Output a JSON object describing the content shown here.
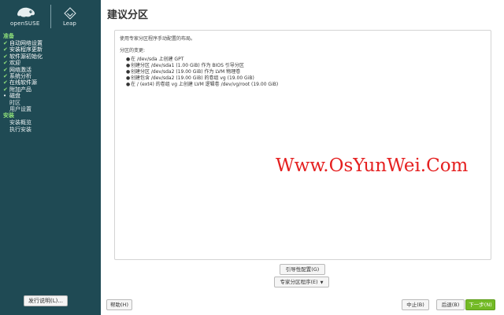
{
  "brand": {
    "opensuse_text": "openSUSE",
    "leap_text": "Leap"
  },
  "steps": {
    "group_prepare": "准备",
    "prepare_items": [
      {
        "label": "自动网络设置",
        "state": "done"
      },
      {
        "label": "安装程序更新",
        "state": "done"
      },
      {
        "label": "软件源初始化",
        "state": "done"
      },
      {
        "label": "欢迎",
        "state": "done"
      },
      {
        "label": "网络激活",
        "state": "done"
      },
      {
        "label": "系统分析",
        "state": "done"
      },
      {
        "label": "在线软件源",
        "state": "done"
      },
      {
        "label": "附加产品",
        "state": "done"
      },
      {
        "label": "磁盘",
        "state": "current"
      },
      {
        "label": "时区",
        "state": "pending"
      },
      {
        "label": "用户设置",
        "state": "pending"
      }
    ],
    "group_install": "安装",
    "install_items": [
      {
        "label": "安装概览",
        "state": "pending"
      },
      {
        "label": "执行安装",
        "state": "pending"
      }
    ]
  },
  "sidebar": {
    "release_notes_label": "发行说明(L)..."
  },
  "main": {
    "title": "建议分区",
    "description": "使用专家分区程序手动配置的布局。",
    "changes_title": "分区的变更:",
    "changes": [
      "在 /dev/sda 上创建 GPT",
      "创建分区 /dev/sda1 (1.00 GiB) 作为 BIOS 引导分区",
      "创建分区 /dev/sda2 (19.00 GiB) 作为 LVM 物理卷",
      "创建包含 /dev/sda2 (19.00 GiB) 的卷组 vg (19.00 GiB)",
      "在 / (ext4) 的卷组 vg 上创建 LVM 逻辑卷 /dev/vg/root (19.00 GiB)"
    ],
    "watermark": "Www.OsYunWei.Com",
    "guided_setup_label": "引导性配置(G)",
    "expert_partitioner_label": "专家分区程序(E)"
  },
  "footer": {
    "help_label": "帮助(H)",
    "abort_label": "中止(B)",
    "back_label": "后退(B)",
    "next_label": "下一步(N)"
  },
  "colors": {
    "sidebar_bg": "#1f4a54",
    "accent_green": "#73ba25",
    "check_green": "#8fe07a",
    "watermark_red": "#e52020"
  },
  "icons": {
    "done": "check-icon",
    "current": "bullet-icon"
  }
}
